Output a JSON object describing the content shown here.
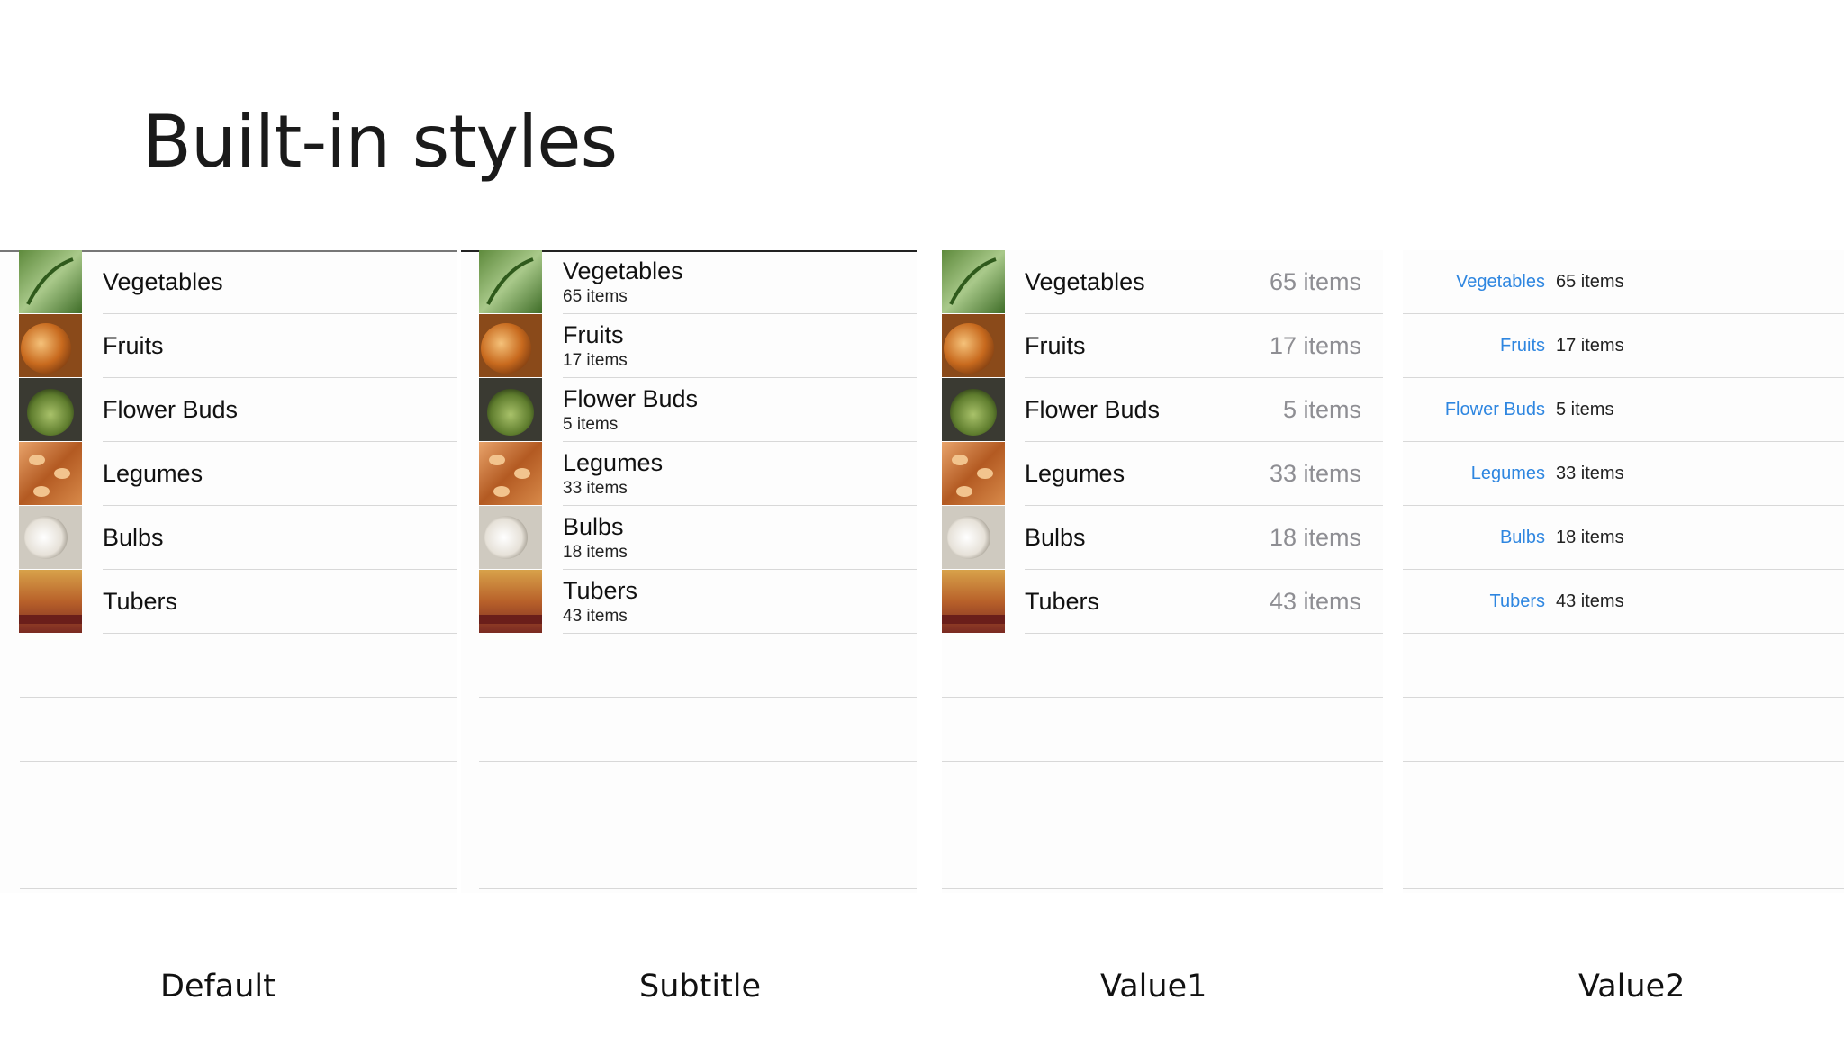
{
  "slide": {
    "title": "Built-in styles"
  },
  "colors": {
    "detail_blue": "#2e86e0",
    "detail_gray": "#8e8e93",
    "separator": "#d8d8d8"
  },
  "rows": [
    {
      "title": "Vegetables",
      "detail": "65 items",
      "thumb_icon": "vegetables-photo"
    },
    {
      "title": "Fruits",
      "detail": "17 items",
      "thumb_icon": "fruits-photo"
    },
    {
      "title": "Flower Buds",
      "detail": "5 items",
      "thumb_icon": "flower-buds-photo"
    },
    {
      "title": "Legumes",
      "detail": "33 items",
      "thumb_icon": "legumes-photo"
    },
    {
      "title": "Bulbs",
      "detail": "18 items",
      "thumb_icon": "bulbs-photo"
    },
    {
      "title": "Tubers",
      "detail": "43 items",
      "thumb_icon": "tubers-photo"
    }
  ],
  "captions": {
    "default": "Default",
    "subtitle": "Subtitle",
    "value1": "Value1",
    "value2": "Value2"
  }
}
